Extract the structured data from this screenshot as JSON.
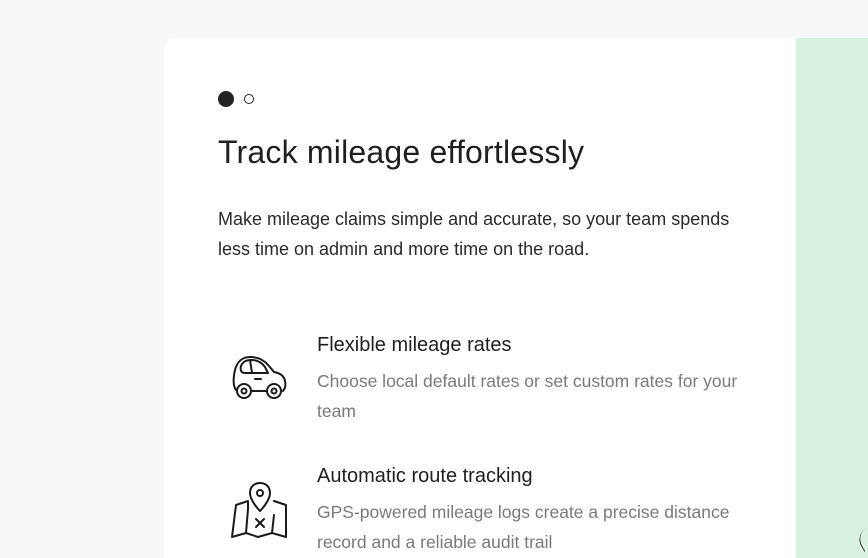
{
  "onboarding": {
    "pagination": {
      "total": 2,
      "active_index": 0
    },
    "title": "Track mileage effortlessly",
    "description": "Make mileage claims simple and accurate, so your team spends less time on admin and more time on the road.",
    "features": [
      {
        "icon": "car-icon",
        "title": "Flexible mileage rates",
        "description": "Choose local default rates or set custom rates for your team"
      },
      {
        "icon": "map-pin-icon",
        "title": "Automatic route tracking",
        "description": "GPS-powered mileage logs create a precise distance record and a reliable audit trail"
      }
    ]
  },
  "colors": {
    "page_background": "#f7f7f7",
    "card_background": "#ffffff",
    "side_panel": "#d8f0e0",
    "text_primary": "#1f1f1f",
    "text_secondary": "#7a7a7a"
  }
}
